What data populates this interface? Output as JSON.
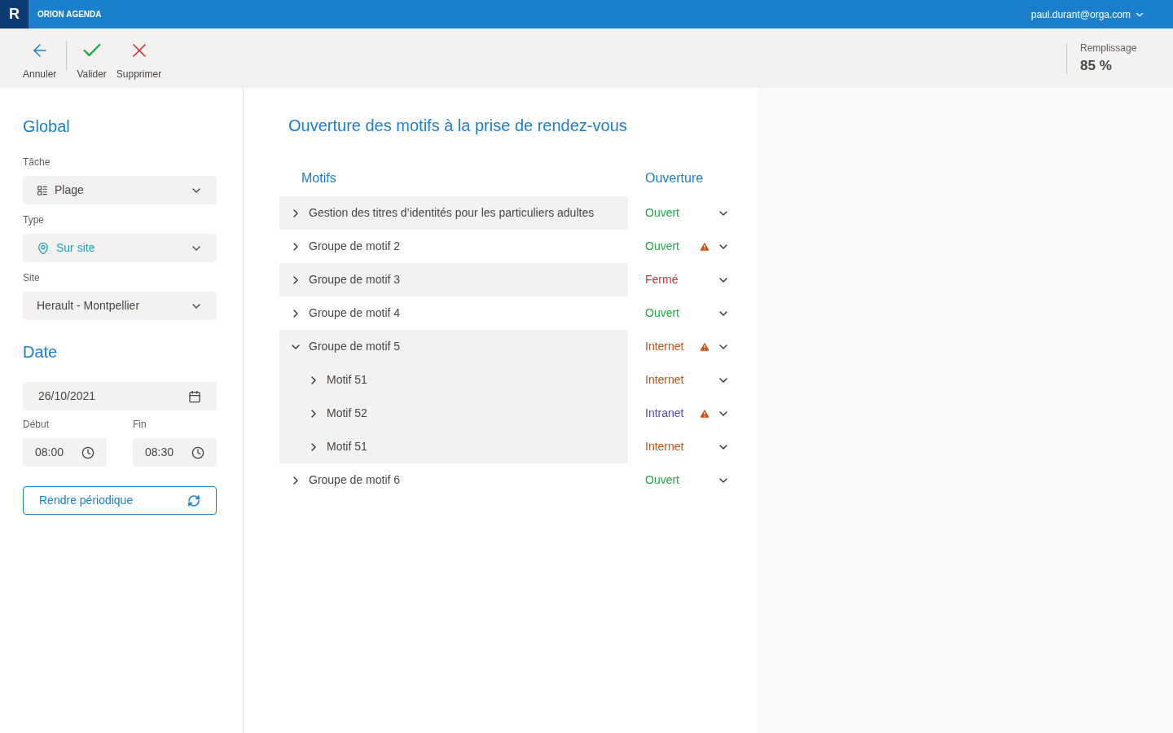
{
  "header": {
    "logo": "R",
    "app_name": "ORION AGENDA",
    "user": "paul.durant@orga.com"
  },
  "toolbar": {
    "actions": [
      {
        "kind": "back",
        "label": "Annuler"
      },
      {
        "kind": "confirm",
        "label": "Valider"
      },
      {
        "kind": "delete",
        "label": "Supprimer"
      }
    ],
    "stat": {
      "label": "Remplissage",
      "value": "85 %"
    }
  },
  "sidebar": {
    "global_title": "Global",
    "fields": [
      {
        "label": "Tâche",
        "value": "Plage",
        "kind": "task"
      },
      {
        "label": "Type",
        "value": "Sur site",
        "kind": "location"
      },
      {
        "label": "Site",
        "value": "Herault - Montpellier",
        "kind": "plain"
      }
    ],
    "date_title": "Date",
    "date": "26/10/2021",
    "start_label": "Début",
    "start": "08:00",
    "end_label": "Fin",
    "end": "08:30",
    "periodic_button": "Rendre périodique"
  },
  "main": {
    "title": "Ouverture des motifs à la prise de rendez-vous",
    "columns": [
      "Motifs",
      "Ouverture"
    ],
    "rows": [
      {
        "label": "Gestion des titres d’identités pour les particuliers adultes",
        "status": "Ouvert",
        "color": "#1fa84a",
        "warning": false,
        "expanded": false
      },
      {
        "label": "Groupe de motif 2",
        "status": "Ouvert",
        "color": "#1fa84a",
        "warning": true,
        "expanded": false
      },
      {
        "label": "Groupe de motif 3",
        "status": "Fermé",
        "color": "#d13438",
        "warning": false,
        "expanded": false
      },
      {
        "label": "Groupe de motif 4",
        "status": "Ouvert",
        "color": "#1fa84a",
        "warning": false,
        "expanded": false
      },
      {
        "label": "Groupe de motif 5",
        "status": "Internet",
        "color": "#ca5010",
        "warning": true,
        "expanded": true,
        "children": [
          {
            "label": "Motif 51",
            "status": "Internet",
            "color": "#ca5010",
            "warning": false,
            "expanded": false
          },
          {
            "label": "Motif 52",
            "status": "Intranet",
            "color": "#4f46e5",
            "warning": true,
            "expanded": false
          },
          {
            "label": "Motif 51",
            "status": "Internet",
            "color": "#ca5010",
            "warning": false,
            "expanded": false
          }
        ]
      },
      {
        "label": "Groupe de motif 6",
        "status": "Ouvert",
        "color": "#1fa84a",
        "warning": false,
        "expanded": false
      }
    ]
  }
}
